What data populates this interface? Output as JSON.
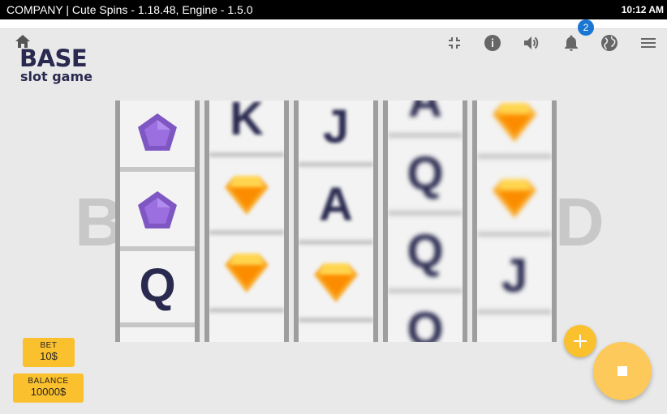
{
  "titlebar": {
    "title": "COMPANY | Cute Spins - 1.18.48, Engine - 1.5.0",
    "time": "10:12 AM"
  },
  "logo": {
    "line1": "BASE",
    "line2": "slot game"
  },
  "toolbar": {
    "icons": [
      "home-icon",
      "fullscreen-exit-icon",
      "info-icon",
      "volume-icon",
      "bell-icon",
      "globe-icon",
      "menu-icon"
    ],
    "notification_count": "2"
  },
  "background_word": {
    "part1": "B",
    "part2": "D"
  },
  "reels": [
    {
      "symbols": [
        "pentagon-gem",
        "pentagon-gem",
        "Q"
      ]
    },
    {
      "symbols": [
        "K",
        "orange-diamond",
        "orange-diamond"
      ]
    },
    {
      "symbols": [
        "J",
        "A",
        "orange-diamond"
      ]
    },
    {
      "symbols": [
        "A",
        "Q",
        "Q"
      ]
    },
    {
      "symbols": [
        "orange-diamond",
        "orange-diamond",
        "J"
      ]
    }
  ],
  "bet": {
    "label": "BET",
    "value": "10$"
  },
  "balance": {
    "label": "BALANCE",
    "value": "10000$"
  },
  "colors": {
    "accent": "#fbc02d",
    "stop_button": "#fdc95a",
    "badge": "#1976d2",
    "symbol_text": "#2a2a50",
    "gem_purple": "#7e57c2"
  }
}
